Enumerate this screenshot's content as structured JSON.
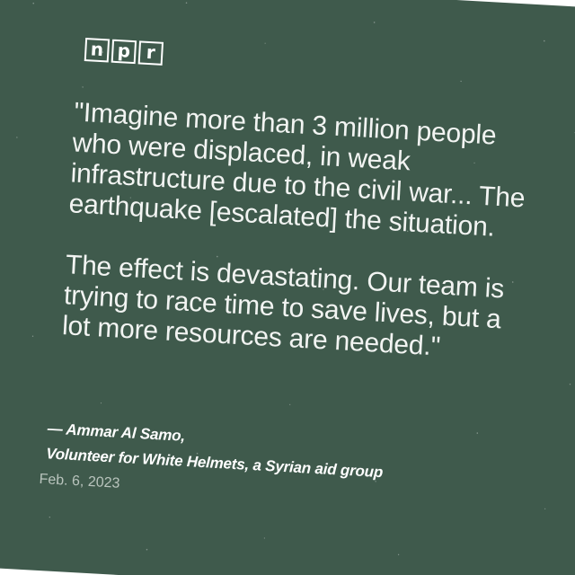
{
  "brand": {
    "letters": [
      "n",
      "p",
      "r"
    ]
  },
  "quote": {
    "paragraph_1": "\"Imagine more than 3 million people who were displaced, in weak infrastructure due to the civil war... The earthquake [escalated] the situation.",
    "paragraph_2": "The effect is devastating. Our team is trying to race time to save lives, but a lot more resources are needed.\""
  },
  "attribution": {
    "name": "— Ammar Al Samo,",
    "role": "Volunteer for White Helmets, a Syrian aid group",
    "date": "Feb. 6, 2023"
  },
  "colors": {
    "background": "#3f5a4c",
    "text": "#ffffff",
    "date_text": "#b9c4bd"
  }
}
